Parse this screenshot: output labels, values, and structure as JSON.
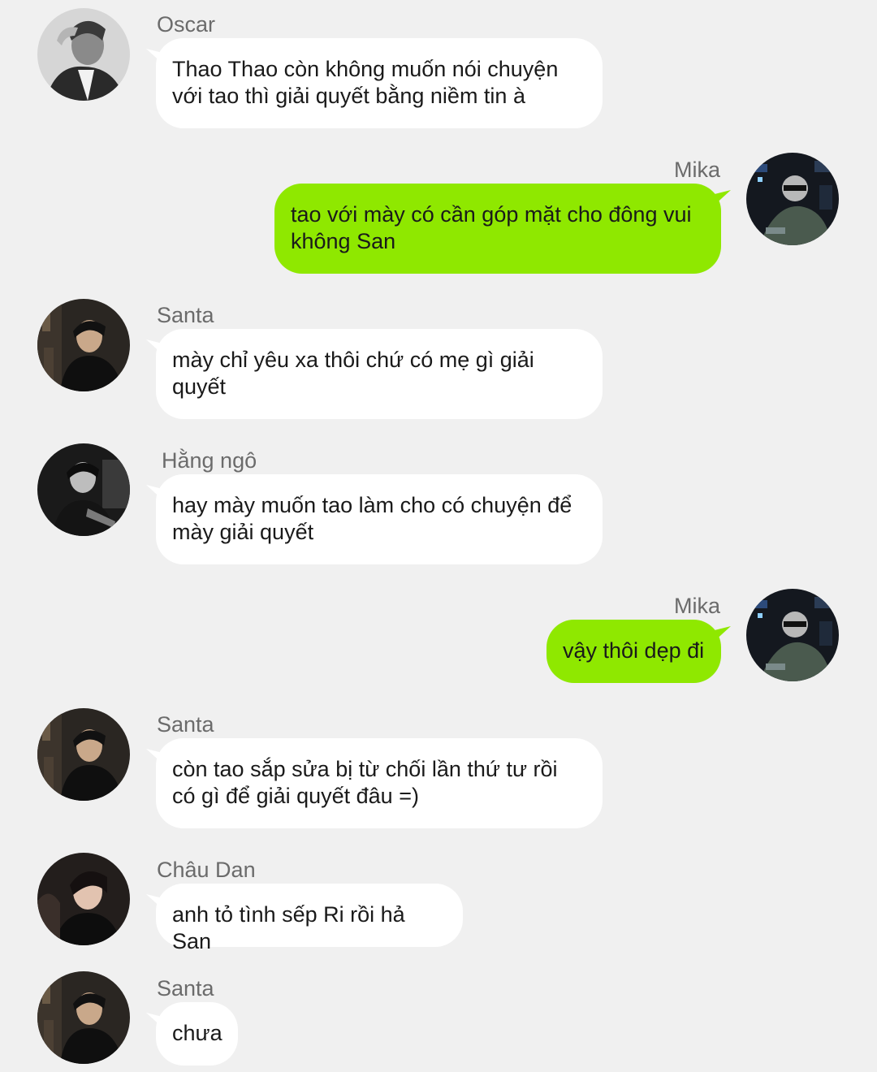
{
  "theme": {
    "incoming_bubble": "#ffffff",
    "outgoing_bubble": "#8fe800",
    "background": "#f0f0f0",
    "name_color": "#6b6b6b"
  },
  "messages": [
    {
      "sender": "Oscar",
      "text": "Thao Thao còn không muốn nói chuyện với tao thì giải quyết bằng niềm tin à",
      "direction": "incoming",
      "avatar": "oscar-avatar"
    },
    {
      "sender": "Mika",
      "text": "tao với mày có cần góp mặt cho đông vui không San",
      "direction": "outgoing",
      "avatar": "mika-avatar"
    },
    {
      "sender": "Santa",
      "text": "mày chỉ yêu xa thôi chứ có mẹ gì giải quyết",
      "direction": "incoming",
      "avatar": "santa-avatar"
    },
    {
      "sender": "Hằng ngô",
      "text": "hay mày muốn tao làm cho có chuyện để mày giải quyết",
      "direction": "incoming",
      "avatar": "hang-ngo-avatar"
    },
    {
      "sender": "Mika",
      "text": "vậy thôi dẹp đi",
      "direction": "outgoing",
      "avatar": "mika-avatar"
    },
    {
      "sender": "Santa",
      "text": "còn tao sắp sửa bị từ chối lần thứ tư rồi có gì để giải quyết đâu =)",
      "direction": "incoming",
      "avatar": "santa-avatar"
    },
    {
      "sender": "Châu Dan",
      "text": "anh tỏ tình sếp Ri rồi hả San",
      "direction": "incoming",
      "avatar": "chau-dan-avatar"
    },
    {
      "sender": "Santa",
      "text": "chưa",
      "direction": "incoming",
      "avatar": "santa-avatar"
    }
  ]
}
